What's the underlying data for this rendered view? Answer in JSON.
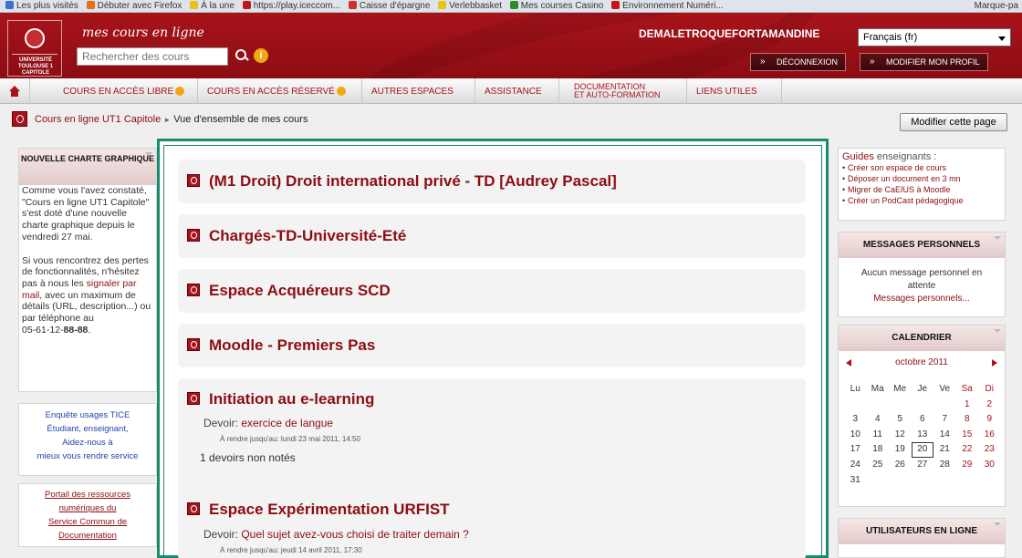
{
  "bookmarks": [
    "Les plus visités",
    "Débuter avec Firefox",
    "À la une",
    "https://play.iceccom...",
    "Caisse d'épargne",
    "Verlebbasket",
    "Mes courses Casino",
    "Environnement Numéri..."
  ],
  "bookmarks_right": "Marque-pa",
  "header": {
    "logo_text": "UNIVERSITÉ TOULOUSE 1 CAPITOLE",
    "brand": "mes cours en ligne",
    "search_placeholder": "Rechercher des cours",
    "username": "DEMALETROQUEFORTAMANDINE",
    "language": "Français (fr)",
    "logout_label": "DÉCONNEXION",
    "profile_label": "MODIFIER MON PROFIL"
  },
  "nav": {
    "items": [
      {
        "label": "COURS EN ACCÈS LIBRE"
      },
      {
        "label": "COURS EN ACCÈS RÉSERVÉ"
      },
      {
        "label": "AUTRES ESPACES"
      },
      {
        "label": "ASSISTANCE"
      },
      {
        "label": "DOCUMENTATION",
        "label2": "ET AUTO-FORMATION"
      },
      {
        "label": "LIENS UTILES"
      }
    ]
  },
  "breadcrumb": {
    "home": "Cours en ligne UT1 Capitole",
    "separator": "►",
    "current": "Vue d'ensemble de mes cours"
  },
  "modify_page_label": "Modifier cette page",
  "left": {
    "charte_title": "NOUVELLE CHARTE GRAPHIQUE",
    "charte_p1": "Comme vous l'avez constaté, \"Cours en ligne UT1 Capitole\" s'est doté d'une nouvelle charte graphique depuis le vendredi 27 mai.",
    "charte_p2_a": "Si vous rencontrez des pertes de fonctionnalités, n'hésitez pas à nous les ",
    "charte_p2_link": "signaler par mail",
    "charte_p2_b": ", avec un maximum de détails (URL, description...) ou par téléphone au",
    "phone_prefix": "05-61-12-",
    "phone_bold": "88-88",
    "phone_suffix": ".",
    "survey_title": "Enquête usages TICE",
    "survey_l1": "Étudiant, enseignant,",
    "survey_l2": "Aidez-nous à",
    "survey_l3": "mieux vous rendre service",
    "portal_l1": "Portail des ressources",
    "portal_l2": "numériques du",
    "portal_l3": "Service Commun de",
    "portal_l4": "Documentation"
  },
  "courses": [
    {
      "title": "(M1 Droit) Droit international privé - TD [Audrey Pascal]"
    },
    {
      "title": "Chargés-TD-Université-Eté"
    },
    {
      "title": "Espace Acquéreurs SCD"
    },
    {
      "title": "Moodle - Premiers Pas"
    },
    {
      "title": "Initiation au e-learning",
      "assign_prefix": "Devoir: ",
      "assign_link": "exercice de langue",
      "due": "À rendre jusqu'au: lundi 23 mai 2011, 14:50",
      "ungraded": "1 devoirs non notés"
    },
    {
      "title": "Espace Expérimentation URFIST",
      "assign_prefix": "Devoir: ",
      "assign_link": "Quel sujet avez-vous choisi de traiter demain ?",
      "due": "À rendre jusqu'au: jeudi 14 avril 2011, 17:30"
    }
  ],
  "right": {
    "guides_title": "Guides",
    "guides_title2": " enseignants :",
    "guides": [
      "Créer son espace de cours",
      "Déposer un document en 3 mn",
      "Migrer de CaEIUS à Moodle",
      "Créer un PodCast pédagogique"
    ],
    "messages_title": "MESSAGES PERSONNELS",
    "messages_empty": "Aucun message personnel en attente",
    "messages_link": "Messages personnels...",
    "calendar_title": "CALENDRIER",
    "calendar_month": "octobre 2011",
    "calendar_days": [
      "Lu",
      "Ma",
      "Me",
      "Je",
      "Ve",
      "Sa",
      "Di"
    ],
    "calendar_weeks": [
      [
        "",
        "",
        "",
        "",
        "",
        "1",
        "2"
      ],
      [
        "3",
        "4",
        "5",
        "6",
        "7",
        "8",
        "9"
      ],
      [
        "10",
        "11",
        "12",
        "13",
        "14",
        "15",
        "16"
      ],
      [
        "17",
        "18",
        "19",
        "20",
        "21",
        "22",
        "23"
      ],
      [
        "24",
        "25",
        "26",
        "27",
        "28",
        "29",
        "30"
      ],
      [
        "31",
        "",
        "",
        "",
        "",
        "",
        ""
      ]
    ],
    "calendar_today": "20",
    "users_title": "UTILISATEURS EN LIGNE"
  },
  "colors": {
    "brand": "#a8131b",
    "accent_border": "#1a8a6e",
    "link": "#8c0d13"
  }
}
